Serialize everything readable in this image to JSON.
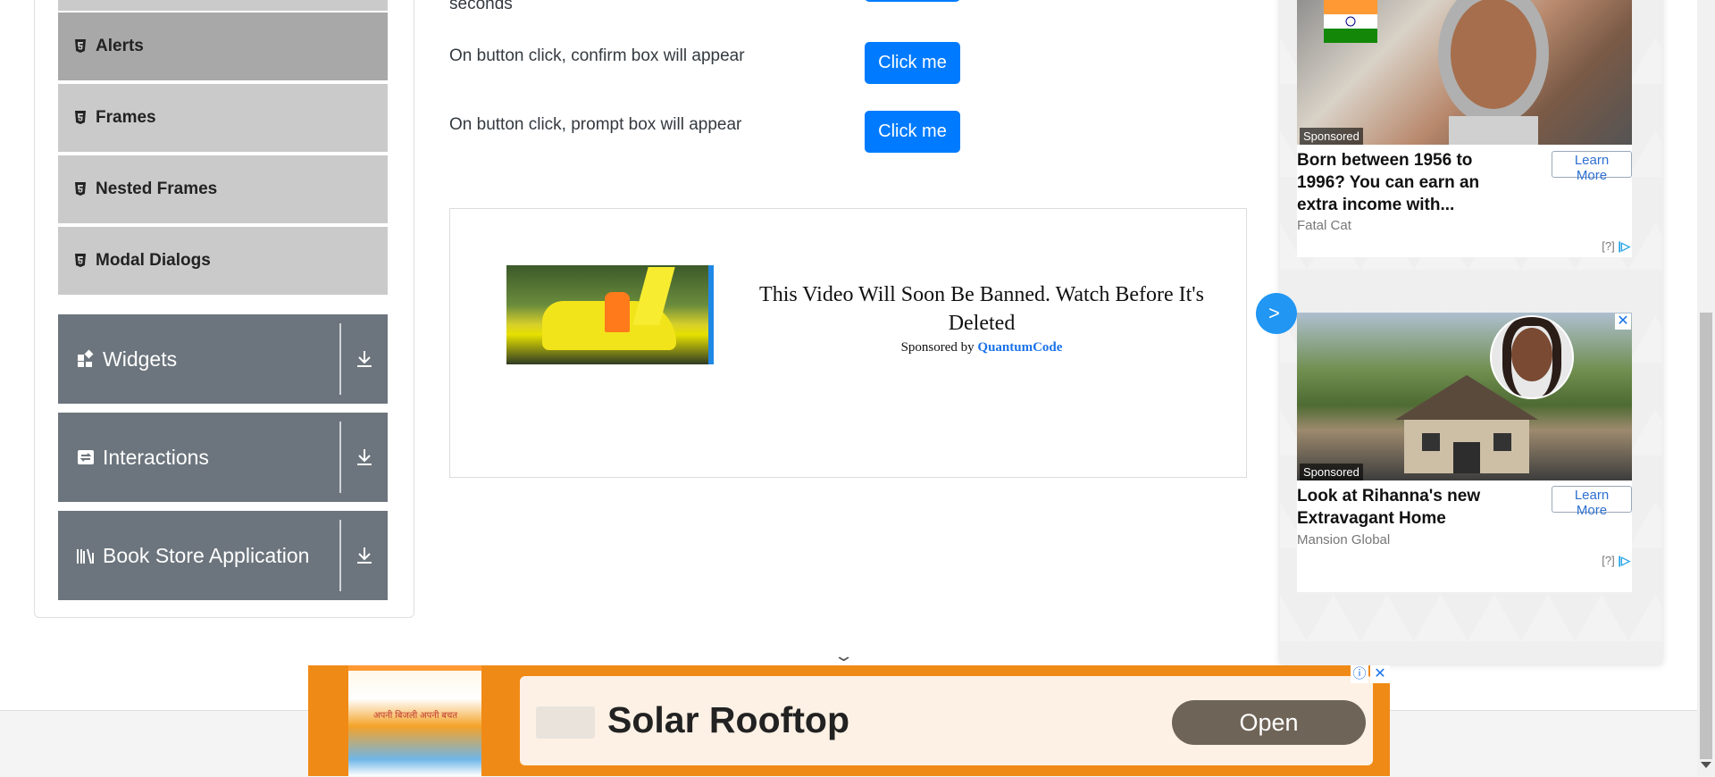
{
  "sidebar": {
    "sub_items": [
      {
        "label": "Alerts",
        "active": true
      },
      {
        "label": "Frames"
      },
      {
        "label": "Nested Frames"
      },
      {
        "label": "Modal Dialogs"
      }
    ],
    "groups": [
      {
        "label": "Widgets",
        "icon": "widgets-icon"
      },
      {
        "label": "Interactions",
        "icon": "interactions-icon"
      },
      {
        "label": "Book Store Application",
        "icon": "books-icon"
      }
    ]
  },
  "main": {
    "partial_desc": "seconds",
    "rows": [
      {
        "desc": "On button click, confirm box will appear",
        "button": "Click me"
      },
      {
        "desc": "On button click, prompt box will appear",
        "button": "Click me"
      }
    ]
  },
  "mid_ad": {
    "headline": "This Video Will Soon Be Banned. Watch Before It's Deleted",
    "sponsored_prefix": "Sponsored by",
    "brand": "QuantumCode",
    "arrow": ">"
  },
  "right_ads": [
    {
      "tag": "Sponsored",
      "title": "Born between 1956 to 1996? You can earn an extra income with...",
      "brand": "Fatal Cat",
      "button": "Learn More",
      "adchoice": "[?]"
    },
    {
      "tag": "Sponsored",
      "title": "Look at Rihanna's new Extravagant Home",
      "brand": "Mansion Global",
      "button": "Learn More",
      "adchoice": "[?]"
    }
  ],
  "bottom_ad": {
    "headline": "Solar Rooftop",
    "button": "Open",
    "poster_text": "अपनी बिजली अपनी बचत"
  },
  "colors": {
    "primary": "#007bff",
    "sidebar_group": "#6c757d",
    "sidebar_item": "#cacaca",
    "sidebar_item_active": "#a8a8a8",
    "bottom_ad_bg": "#f08a16"
  }
}
